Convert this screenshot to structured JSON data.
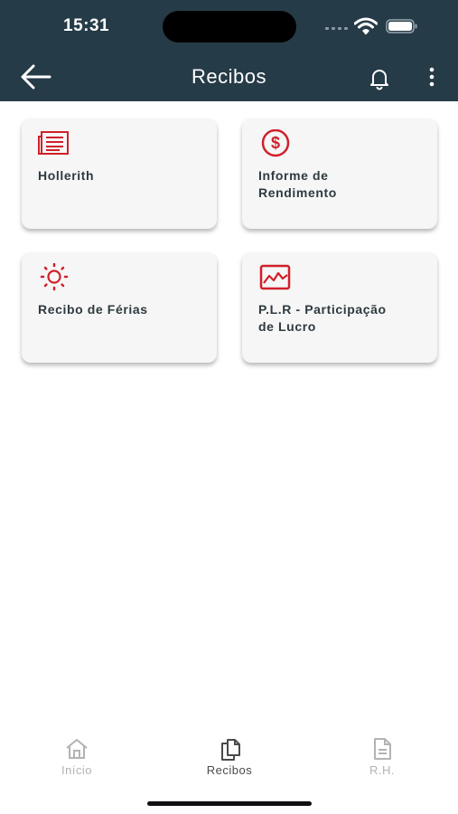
{
  "status_bar": {
    "time": "15:31"
  },
  "header": {
    "title": "Recibos"
  },
  "cards": [
    {
      "label": "Hollerith",
      "icon": "newspaper-icon"
    },
    {
      "label": "Informe de\n Rendimento",
      "icon": "dollar-circle-icon"
    },
    {
      "label": "Recibo de Férias",
      "icon": "sun-icon"
    },
    {
      "label": "P.L.R - Participação\n de Lucro",
      "icon": "chart-icon"
    }
  ],
  "bottom_nav": [
    {
      "label": "Início",
      "icon": "home-icon",
      "active": false
    },
    {
      "label": "Recibos",
      "icon": "documents-icon",
      "active": true
    },
    {
      "label": "R.H.",
      "icon": "document-icon",
      "active": false
    }
  ],
  "colors": {
    "header_bg": "#263b48",
    "accent_red": "#d0202a",
    "card_bg": "#f6f6f6"
  }
}
